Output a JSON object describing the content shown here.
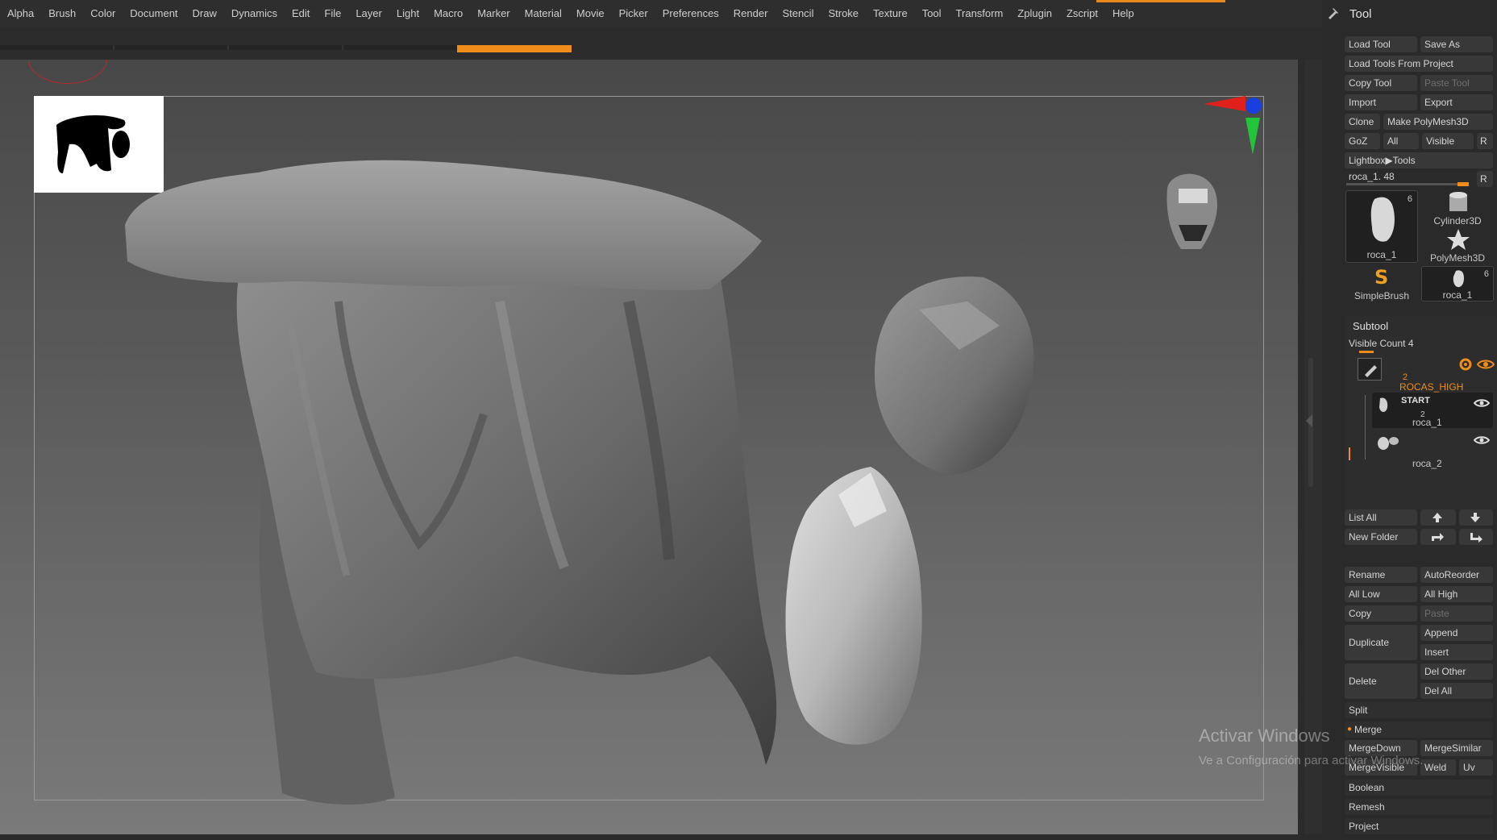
{
  "menu": [
    "Alpha",
    "Brush",
    "Color",
    "Document",
    "Draw",
    "Dynamics",
    "Edit",
    "File",
    "Layer",
    "Light",
    "Macro",
    "Marker",
    "Material",
    "Movie",
    "Picker",
    "Preferences",
    "Render",
    "Stencil",
    "Stroke",
    "Texture",
    "Tool",
    "Transform",
    "Zplugin",
    "Zscript",
    "Help"
  ],
  "panel": {
    "title": "Tool",
    "load_tool": "Load Tool",
    "save_as": "Save As",
    "load_from_project": "Load Tools From Project",
    "copy_tool": "Copy Tool",
    "paste_tool": "Paste Tool",
    "import": "Import",
    "export": "Export",
    "clone": "Clone",
    "make_polymesh": "Make PolyMesh3D",
    "goz": "GoZ",
    "all": "All",
    "visible": "Visible",
    "r": "R",
    "lightbox_tools": "Lightbox▶Tools",
    "slider_label": "roca_1. 48",
    "slider_r": "R",
    "thumbs": [
      {
        "label": "roca_1",
        "badge": "6"
      },
      {
        "label": "Cylinder3D",
        "badge": ""
      },
      {
        "label": "PolyMesh3D",
        "badge": ""
      },
      {
        "label": "SimpleBrush",
        "badge": ""
      },
      {
        "label": "roca_1",
        "badge": "6"
      }
    ]
  },
  "subtool": {
    "title": "Subtool",
    "visible_count": "Visible Count 4",
    "folder_name": "ROCAS_HIGH",
    "folder_count": "2",
    "start_label": "START",
    "items": [
      {
        "name": "roca_1",
        "count": "2"
      },
      {
        "name": "roca_2",
        "count": ""
      }
    ],
    "list_all": "List All",
    "new_folder": "New Folder",
    "rename": "Rename",
    "auto_reorder": "AutoReorder",
    "all_low": "All Low",
    "all_high": "All High",
    "copy": "Copy",
    "paste": "Paste",
    "duplicate": "Duplicate",
    "append": "Append",
    "insert": "Insert",
    "delete": "Delete",
    "del_other": "Del Other",
    "del_all": "Del All",
    "split": "Split",
    "merge": "Merge",
    "merge_down": "MergeDown",
    "merge_similar": "MergeSimilar",
    "merge_visible": "MergeVisible",
    "weld": "Weld",
    "uv": "Uv",
    "boolean": "Boolean",
    "remesh": "Remesh",
    "project": "Project"
  },
  "watermark": {
    "line1": "Activar Windows",
    "line2": "Ve a Configuración para activar Windows."
  },
  "colors": {
    "accent_orange": "#f08c1a",
    "gizmo_red": "#e0201a",
    "gizmo_green": "#22c43a",
    "gizmo_blue": "#1a3fe0"
  }
}
